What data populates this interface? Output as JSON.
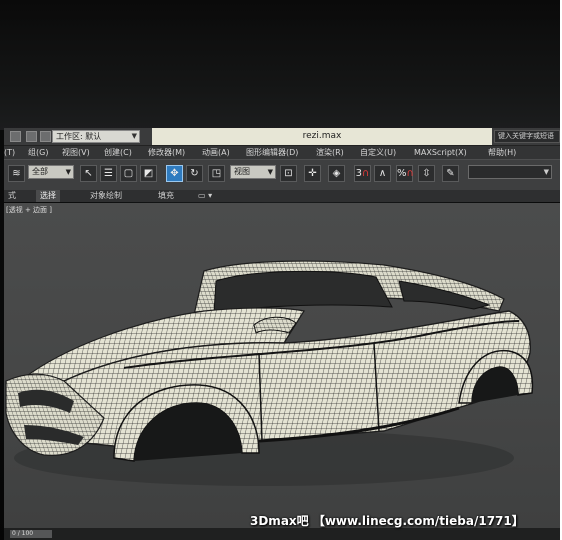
{
  "titlebar": {
    "workspace": "工作区: 默认",
    "document_title": "rezi.max",
    "search_placeholder": "键入关键字或短语"
  },
  "menubar": {
    "items": [
      "(T)",
      "组(G)",
      "视图(V)",
      "创建(C)",
      "修改器(M)",
      "动画(A)",
      "图形编辑器(D)",
      "渲染(R)",
      "自定义(U)",
      "MAXScript(X)",
      "帮助(H)"
    ]
  },
  "toolbar": {
    "filter_select": "全部",
    "view_select": "视图",
    "snap_labels": [
      "3",
      "%",
      "n"
    ]
  },
  "ribbon": {
    "tabs": [
      "式",
      "选择",
      "对象绘制",
      "填充"
    ]
  },
  "viewport": {
    "label": "[透视 + 边面 ]"
  },
  "timebar": {
    "frame": "0 / 100"
  },
  "watermark": "3Dmax吧 【www.linecg.com/tieba/1771】",
  "colors": {
    "viewport_bg": "#464747",
    "mesh_fill": "#e4e3d3",
    "mesh_lines": "#1d1d1d",
    "active_button": "#2f7bbf"
  }
}
